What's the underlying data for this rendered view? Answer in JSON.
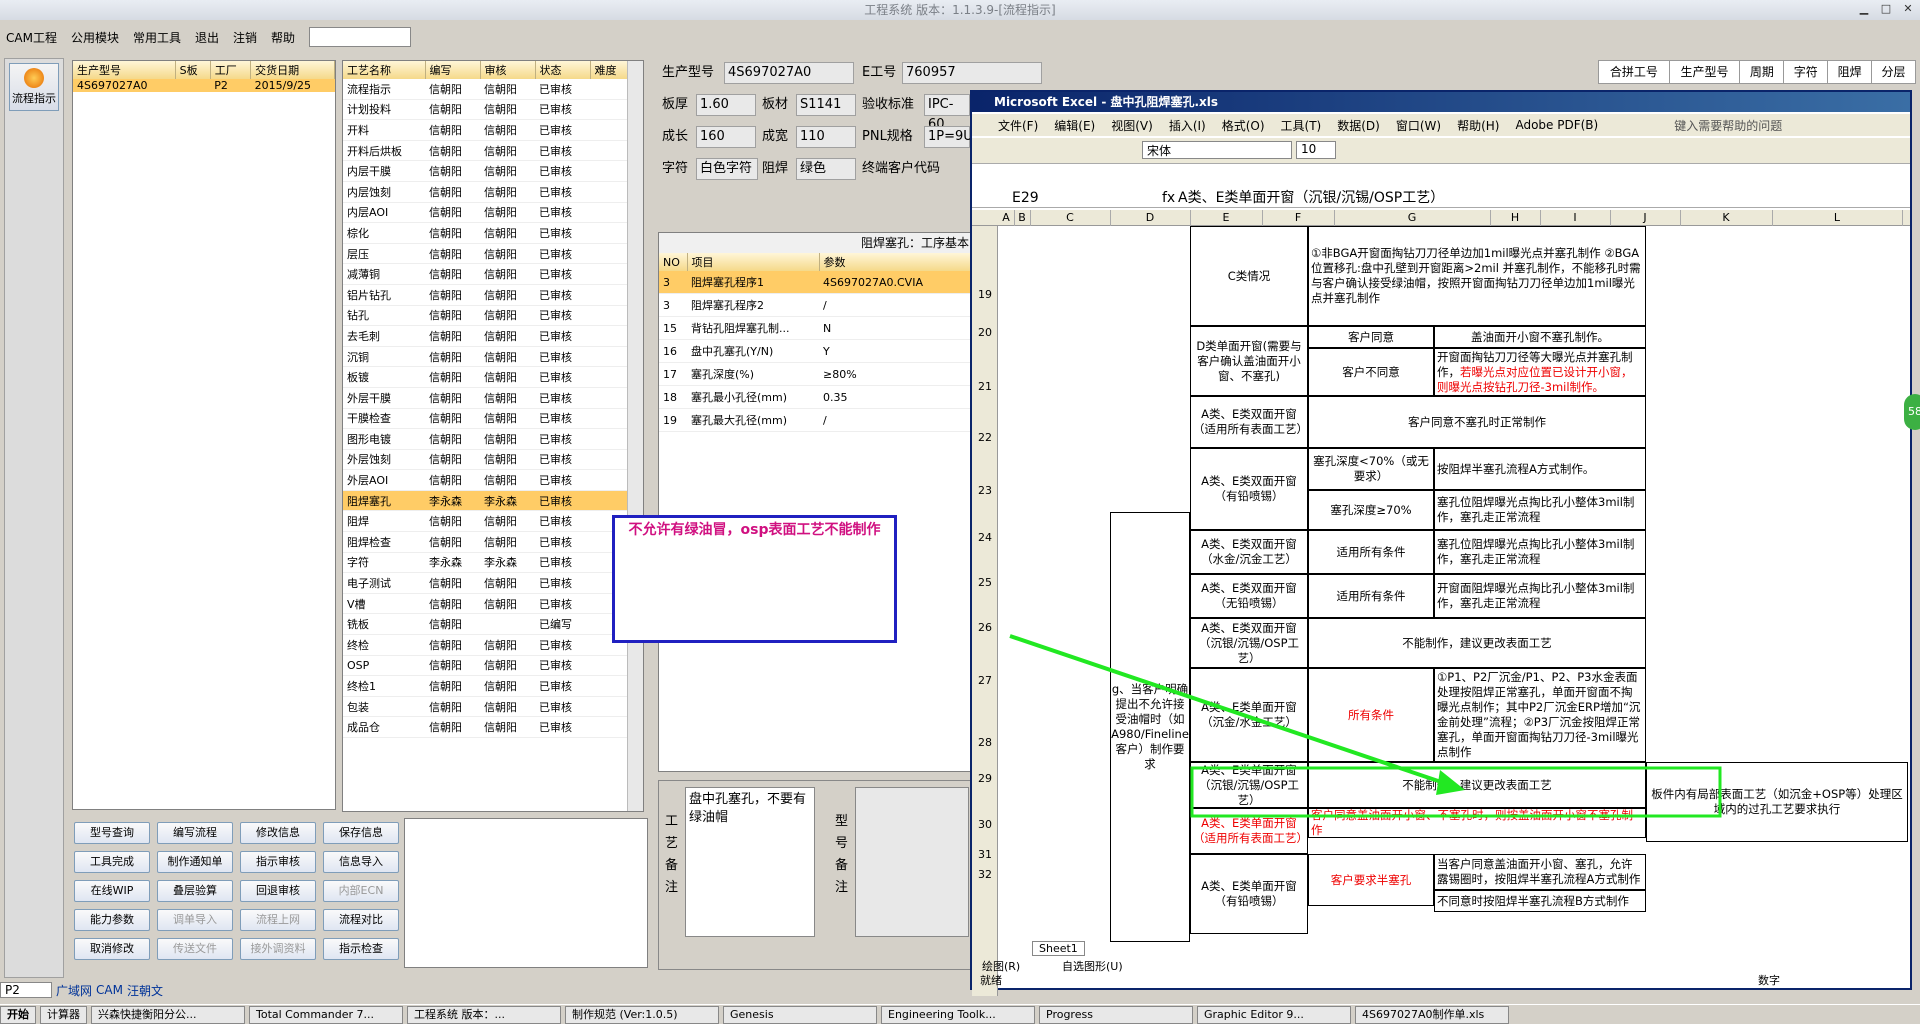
{
  "window": {
    "title": "工程系统 版本：1.1.3.9-[流程指示]"
  },
  "menu": [
    "CAM工程",
    "公用模块",
    "常用工具",
    "退出",
    "注销",
    "帮助"
  ],
  "nav": {
    "flow_label": "流程指示"
  },
  "order_table": {
    "headers": [
      "生产型号",
      "S板",
      "工厂",
      "交货日期"
    ],
    "rows": [
      [
        "4S697027A0",
        "",
        "P2",
        "2015/9/25"
      ]
    ]
  },
  "process_table": {
    "headers": [
      "工艺名称",
      "编写",
      "审核",
      "状态",
      "难度"
    ],
    "rows": [
      [
        "流程指示",
        "信朝阳",
        "信朝阳",
        "已审核",
        ""
      ],
      [
        "计划投料",
        "信朝阳",
        "信朝阳",
        "已审核",
        ""
      ],
      [
        "开料",
        "信朝阳",
        "信朝阳",
        "已审核",
        ""
      ],
      [
        "开料后烘板",
        "信朝阳",
        "信朝阳",
        "已审核",
        ""
      ],
      [
        "内层干膜",
        "信朝阳",
        "信朝阳",
        "已审核",
        ""
      ],
      [
        "内层蚀刻",
        "信朝阳",
        "信朝阳",
        "已审核",
        ""
      ],
      [
        "内层AOI",
        "信朝阳",
        "信朝阳",
        "已审核",
        ""
      ],
      [
        "棕化",
        "信朝阳",
        "信朝阳",
        "已审核",
        ""
      ],
      [
        "层压",
        "信朝阳",
        "信朝阳",
        "已审核",
        ""
      ],
      [
        "减薄铜",
        "信朝阳",
        "信朝阳",
        "已审核",
        ""
      ],
      [
        "铝片钻孔",
        "信朝阳",
        "信朝阳",
        "已审核",
        ""
      ],
      [
        "钻孔",
        "信朝阳",
        "信朝阳",
        "已审核",
        ""
      ],
      [
        "去毛刺",
        "信朝阳",
        "信朝阳",
        "已审核",
        ""
      ],
      [
        "沉铜",
        "信朝阳",
        "信朝阳",
        "已审核",
        ""
      ],
      [
        "板镀",
        "信朝阳",
        "信朝阳",
        "已审核",
        ""
      ],
      [
        "外层干膜",
        "信朝阳",
        "信朝阳",
        "已审核",
        ""
      ],
      [
        "干膜检查",
        "信朝阳",
        "信朝阳",
        "已审核",
        ""
      ],
      [
        "图形电镀",
        "信朝阳",
        "信朝阳",
        "已审核",
        ""
      ],
      [
        "外层蚀刻",
        "信朝阳",
        "信朝阳",
        "已审核",
        ""
      ],
      [
        "外层AOI",
        "信朝阳",
        "信朝阳",
        "已审核",
        ""
      ],
      [
        "阻焊塞孔",
        "李永森",
        "李永森",
        "已审核",
        ""
      ],
      [
        "阻焊",
        "信朝阳",
        "信朝阳",
        "已审核",
        ""
      ],
      [
        "阻焊检查",
        "信朝阳",
        "信朝阳",
        "已审核",
        ""
      ],
      [
        "字符",
        "李永森",
        "李永森",
        "已审核",
        ""
      ],
      [
        "电子测试",
        "信朝阳",
        "信朝阳",
        "已审核",
        ""
      ],
      [
        "V槽",
        "信朝阳",
        "信朝阳",
        "已审核",
        ""
      ],
      [
        "铣板",
        "信朝阳",
        "",
        "已编写",
        ""
      ],
      [
        "终检",
        "信朝阳",
        "信朝阳",
        "已审核",
        ""
      ],
      [
        "OSP",
        "信朝阳",
        "信朝阳",
        "已审核",
        ""
      ],
      [
        "终检1",
        "信朝阳",
        "信朝阳",
        "已审核",
        ""
      ],
      [
        "包装",
        "信朝阳",
        "信朝阳",
        "已审核",
        ""
      ],
      [
        "成品仓",
        "信朝阳",
        "信朝阳",
        "已审核",
        ""
      ]
    ]
  },
  "buttons": [
    [
      "型号查询",
      "编写流程",
      "修改信息",
      "保存信息"
    ],
    [
      "工具完成",
      "制作通知单",
      "指示审核",
      "信息导入"
    ],
    [
      "在线WIP",
      "叠层验算",
      "回退审核",
      "内部ECN"
    ],
    [
      "能力参数",
      "调单导入",
      "流程上网",
      "流程对比"
    ],
    [
      "取消修改",
      "传送文件",
      "接外调资料",
      "指示检查"
    ]
  ],
  "info": {
    "model_label": "生产型号",
    "model": "4S697027A0",
    "e_label": "E工号",
    "e_no": "760957",
    "thick_label": "板厚",
    "thick": "1.60",
    "mat_label": "板材",
    "mat": "S1141",
    "std_label": "验收标准",
    "std": "IPC-60",
    "len_label": "成长",
    "len": "160",
    "wid_label": "成宽",
    "wid": "110",
    "pnl_label": "PNL规格",
    "pnl": "1P=9U",
    "char_label": "字符",
    "char": "白色字符",
    "sm_label": "阻焊",
    "sm": "绿色",
    "cust_label": "终端客户代码"
  },
  "right_tabs": [
    "合拼工号",
    "生产型号",
    "周期",
    "字符",
    "阻焊",
    "分层"
  ],
  "param_table": {
    "title": "阻焊塞孔：工序基本",
    "headers": [
      "NO",
      "项目",
      "参数"
    ],
    "rows": [
      [
        "3",
        "阻焊塞孔程序1",
        "4S697027A0.CVIA"
      ],
      [
        "3",
        "阻焊塞孔程序2",
        "/"
      ],
      [
        "15",
        "背钻孔阻焊塞孔制...",
        "N"
      ],
      [
        "16",
        "盘中孔塞孔(Y/N)",
        "Y"
      ],
      [
        "17",
        "塞孔深度(%)",
        "≥80%"
      ],
      [
        "18",
        "塞孔最小孔径(mm)",
        "0.35"
      ],
      [
        "19",
        "塞孔最大孔径(mm)",
        "/"
      ]
    ]
  },
  "note": {
    "text": "不允许有绿油冒，osp表面工艺不能制作"
  },
  "remark": {
    "label": "工艺备注",
    "text": "盘中孔塞孔，不要有绿油帽",
    "model_label": "型号备注"
  },
  "excel": {
    "title": "Microsoft Excel - 盘中孔阻焊塞孔.xls",
    "menu": [
      "文件(F)",
      "编辑(E)",
      "视图(V)",
      "插入(I)",
      "格式(O)",
      "工具(T)",
      "数据(D)",
      "窗口(W)",
      "帮助(H)",
      "Adobe PDF(B)"
    ],
    "help_box": "键入需要帮助的问题",
    "font": "宋体",
    "size": "10",
    "cellref": "E29",
    "formula": "A类、E类单面开窗（沉银/沉锡/OSP工艺）",
    "cols": [
      "A",
      "B",
      "C",
      "D",
      "E",
      "F",
      "G",
      "H",
      "I",
      "J",
      "K",
      "L"
    ],
    "rows": [
      "19",
      "20",
      "21",
      "22",
      "23",
      "24",
      "25",
      "26",
      "27",
      "28",
      "29",
      "30",
      "31",
      "32"
    ],
    "sheet": "Sheet1",
    "status": "就绪",
    "status_right": "数字",
    "draw": "绘图(R)",
    "autoshape": "自选图形(U)",
    "cells": {
      "c19g": "①非BGA开窗面掏钻刀刀径单边加1mil曝光点并塞孔制作 ②BGA位置移孔:盘中孔壁到开窗距离>2mil 并塞孔制作，不能移孔时需与客户确认接受绿油帽，按照开窗面掏钻刀刀径单边加1mil曝光点并塞孔制作",
      "c19e": "C类情况",
      "c20e": "D类单面开窗(需要与客户确认盖油面开小窗、不塞孔)",
      "c20g": "客户同意",
      "c20i": "盖油面开小窗不塞孔制作。",
      "c21g": "客户不同意",
      "c21i": "开窗面掏钻刀刀径等大曝光点并塞孔制作，",
      "c21r": "若曝光点对应位置已设计开小窗，则曝光点按钻孔刀径-3mil制作。",
      "c22e": "A类、E类双面开窗（适用所有表面工艺）",
      "c22g": "客户同意不塞孔时正常制作",
      "c23e": "A类、E类双面开窗（有铅喷锡）",
      "c23g": "塞孔深度<70%（或无要求）",
      "c23i": "按阻焊半塞孔流程A方式制作。",
      "c24g": "塞孔深度≥70%",
      "c24i": "塞孔位阻焊曝光点掏比孔小整体3mil制作，塞孔走正常流程",
      "c25e": "A类、E类双面开窗（水金/沉金工艺）",
      "c25g": "适用所有条件",
      "c25i": "塞孔位阻焊曝光点掏比孔小整体3mil制作，塞孔走正常流程",
      "c26e": "A类、E类双面开窗（无铅喷锡）",
      "c26g": "适用所有条件",
      "c26i": "开窗面阻焊曝光点掏比孔小整体3mil制作，塞孔走正常流程",
      "c27e": "A类、E类双面开窗（沉银/沉锡/OSP工艺）",
      "c27g": "不能制作，建议更改表面工艺",
      "c28e": "A类、E类单面开窗（沉金/水金工艺）",
      "c28g": "所有条件",
      "c28i": "①P1、P2厂沉金/P1、P2、P3水金表面处理按阻焊正常塞孔，单面开窗面不掏曝光点制作；其中P2厂沉金ERP增加“沉金前处理”流程；②P3厂沉金按阻焊正常塞孔，单面开窗面掏钻刀刀径-3mil曝光点制作",
      "c29e": "A类、E类单面开窗（沉银/沉锡/OSP工艺）",
      "c29g": "不能制作，建议更改表面工艺",
      "c29l": "板件内有局部表面工艺（如沉金+OSP等）处理区域内的过孔工艺要求执行",
      "c30e": "A类、E类单面开窗（适用所有表面工艺）",
      "c30g": "客户同意盖油面开小窗、不塞孔时，则按盖油面开小窗不塞孔制作",
      "c31g": "客户要求半塞孔",
      "c31i": "当客户同意盖油面开小窗、塞孔，允许露锡圈时，按阻焊半塞孔流程A方式制作",
      "c31e": "A类、E类单面开窗（有铅喷锡）",
      "c32i": "不同意时按阻焊半塞孔流程B方式制作",
      "c_d": "g、当客户明确提出不允许接受油帽时（如A980/Fineline客户）制作要求"
    }
  },
  "bottom": {
    "combo": "P2",
    "tabs": [
      "广域网",
      "CAM",
      "汪朝文"
    ]
  },
  "taskbar": {
    "start": "开始",
    "items": [
      "计算器",
      "兴森快捷衡阳分公...",
      "Total Commander 7...",
      "工程系统 版本：...",
      "制作规范 (Ver:1.0.5)",
      "Genesis",
      "Engineering Toolk...",
      "Progress",
      "Graphic Editor 9...",
      "4S697027A0制作单.xls"
    ]
  },
  "badge": "58"
}
